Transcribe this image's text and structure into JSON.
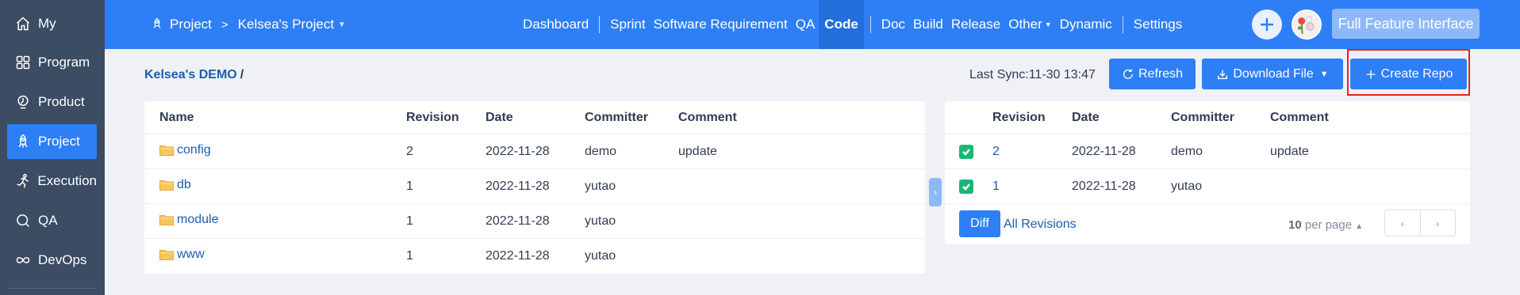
{
  "sidebar": {
    "items": [
      {
        "label": "My",
        "icon": "home-icon"
      },
      {
        "label": "Program",
        "icon": "grid-icon"
      },
      {
        "label": "Product",
        "icon": "product-icon"
      },
      {
        "label": "Project",
        "icon": "rocket-icon",
        "active": true
      },
      {
        "label": "Execution",
        "icon": "run-icon"
      },
      {
        "label": "QA",
        "icon": "search-icon"
      },
      {
        "label": "DevOps",
        "icon": "infinity-icon"
      }
    ]
  },
  "header": {
    "breadcrumb": {
      "root": "Project",
      "separator": ">",
      "current": "Kelsea's Project"
    },
    "nav": [
      {
        "label": "Dashboard"
      },
      {
        "label": "Sprint"
      },
      {
        "label": "Software Requirement"
      },
      {
        "label": "QA"
      },
      {
        "label": "Code",
        "active": true
      },
      {
        "label": "Doc"
      },
      {
        "label": "Build"
      },
      {
        "label": "Release"
      },
      {
        "label": "Other"
      },
      {
        "label": "Dynamic"
      },
      {
        "label": "Settings"
      }
    ],
    "full_feature_label": "Full Feature Interface"
  },
  "toolbar": {
    "repo_name": "Kelsea's DEMO",
    "path_slash": "/",
    "last_sync": "Last Sync:11-30 13:47",
    "refresh_label": "Refresh",
    "download_label": "Download File",
    "create_label": "Create Repo"
  },
  "files_table": {
    "headers": {
      "name": "Name",
      "revision": "Revision",
      "date": "Date",
      "committer": "Committer",
      "comment": "Comment"
    },
    "rows": [
      {
        "name": "config",
        "revision": "2",
        "date": "2022-11-28",
        "committer": "demo",
        "comment": "update"
      },
      {
        "name": "db",
        "revision": "1",
        "date": "2022-11-28",
        "committer": "yutao",
        "comment": ""
      },
      {
        "name": "module",
        "revision": "1",
        "date": "2022-11-28",
        "committer": "yutao",
        "comment": ""
      },
      {
        "name": "www",
        "revision": "1",
        "date": "2022-11-28",
        "committer": "yutao",
        "comment": ""
      }
    ]
  },
  "revisions_table": {
    "headers": {
      "revision": "Revision",
      "date": "Date",
      "committer": "Committer",
      "comment": "Comment"
    },
    "rows": [
      {
        "revision": "2",
        "date": "2022-11-28",
        "committer": "demo",
        "comment": "update",
        "checked": true
      },
      {
        "revision": "1",
        "date": "2022-11-28",
        "committer": "yutao",
        "comment": "",
        "checked": true
      }
    ],
    "diff_label": "Diff",
    "all_revisions_label": "All Revisions",
    "per_page_count": "10",
    "per_page_label": "per page"
  },
  "colors": {
    "primary": "#2e7ff5",
    "sidebar": "#3b4c63",
    "check": "#19b776",
    "highlight": "#e1261c"
  }
}
